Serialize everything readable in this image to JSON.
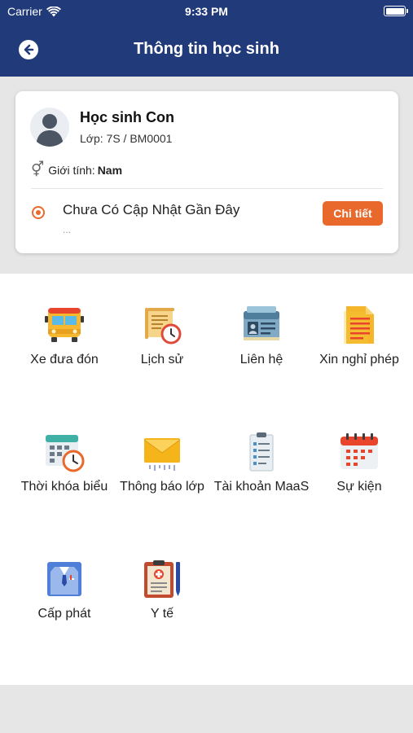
{
  "status_bar": {
    "carrier": "Carrier",
    "time": "9:33 PM"
  },
  "header": {
    "title": "Thông tin học sinh"
  },
  "student": {
    "name": "Học sinh Con",
    "class_label": "Lớp: 7S / BM0001",
    "gender_label": "Giới tính:",
    "gender_value": "Nam",
    "update_text": "Chưa Có Cập Nhật Gần Đây",
    "update_sub": "...",
    "detail_button": "Chi tiết"
  },
  "menu": [
    {
      "label": "Xe đưa đón",
      "icon": "bus-icon"
    },
    {
      "label": "Lịch sử",
      "icon": "history-scroll-icon"
    },
    {
      "label": "Liên hệ",
      "icon": "contact-card-icon"
    },
    {
      "label": "Xin nghỉ phép",
      "icon": "leave-request-icon"
    },
    {
      "label": "Thời khóa biểu",
      "icon": "timetable-icon"
    },
    {
      "label": "Thông báo lớp",
      "icon": "class-notice-envelope-icon"
    },
    {
      "label": "Tài khoản MaaS",
      "icon": "maas-account-icon"
    },
    {
      "label": "Sự kiện",
      "icon": "event-calendar-icon"
    },
    {
      "label": "Cấp phát",
      "icon": "uniform-shirt-icon"
    },
    {
      "label": "Y tế",
      "icon": "medical-clipboard-icon"
    }
  ],
  "colors": {
    "header_bg": "#213a7a",
    "accent": "#e9692c",
    "page_bg": "#e6e6e6"
  }
}
